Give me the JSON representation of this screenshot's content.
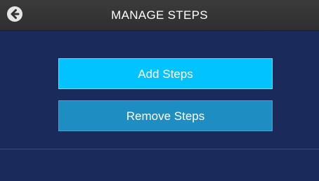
{
  "header": {
    "title": "MANAGE STEPS",
    "back_icon": "arrow-left-circle-icon"
  },
  "actions": {
    "add_label": "Add Steps",
    "remove_label": "Remove Steps"
  },
  "colors": {
    "background": "#1a2a5a",
    "header": "#333333",
    "add_button": "#00c3ff",
    "remove_button": "#1e8ec2"
  }
}
